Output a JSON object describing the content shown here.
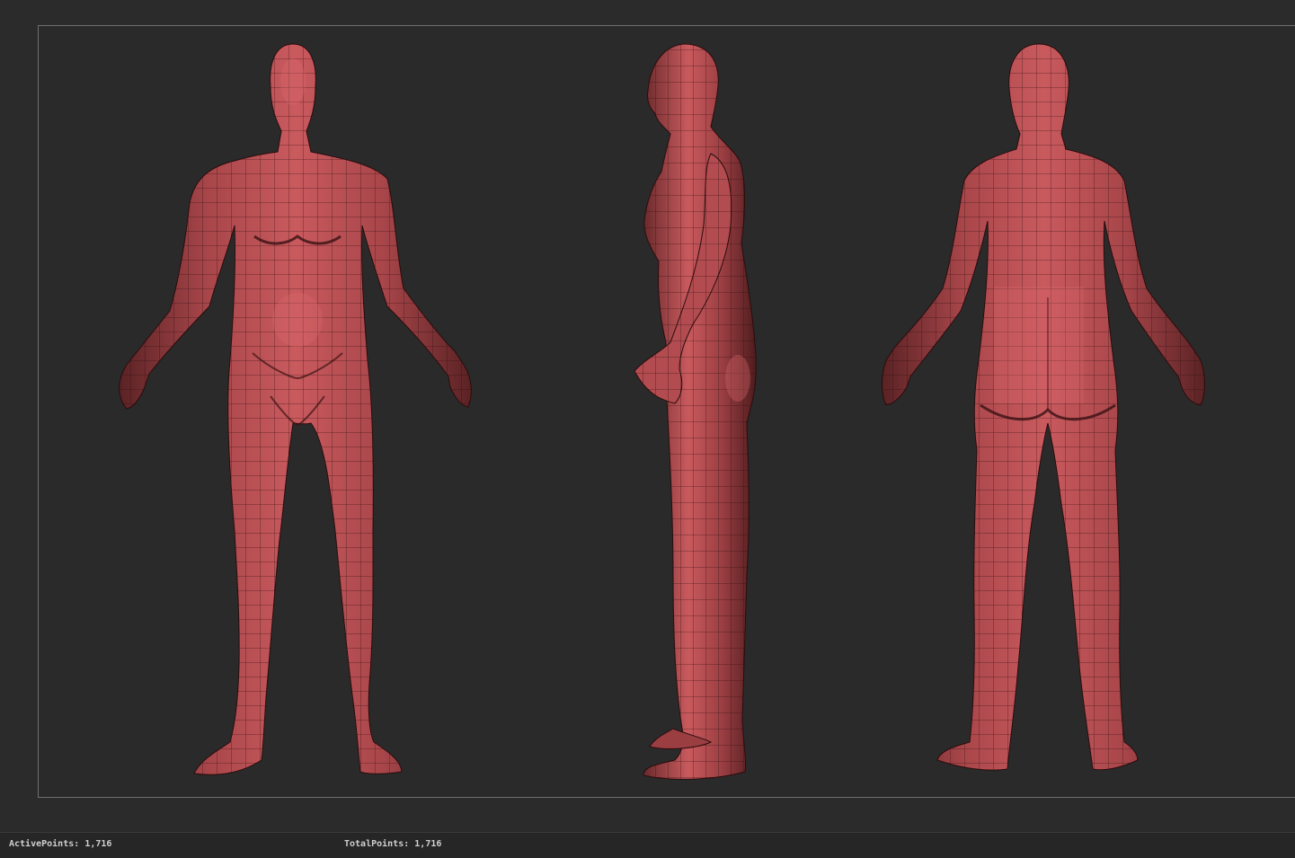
{
  "status": {
    "active_points_label": "ActivePoints:",
    "active_points_value": "1,716",
    "total_points_label": "TotalPoints:",
    "total_points_value": "1,716"
  },
  "views": [
    {
      "name": "front-view"
    },
    {
      "name": "side-view"
    },
    {
      "name": "back-view"
    }
  ],
  "colors": {
    "background": "#2b2b2b",
    "mesh_fill": "#a8464a",
    "mesh_highlight": "#d9686c",
    "mesh_shadow": "#5a2224",
    "wire": "#2a0c0d",
    "frame": "#6e6e6e",
    "status_text": "#cfcfcf"
  }
}
